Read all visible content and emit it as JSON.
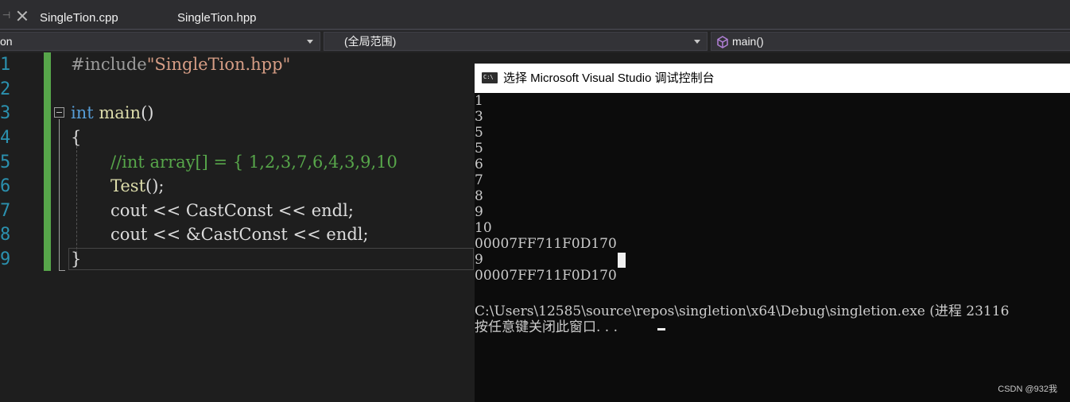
{
  "tabs": [
    {
      "label": "SingleTion.cpp"
    },
    {
      "label": "SingleTion.hpp"
    }
  ],
  "navbar": {
    "project_scope": "on",
    "global_scope": "(全局范围)",
    "function_scope": "main()"
  },
  "editor": {
    "line_numbers": [
      "1",
      "2",
      "3",
      "4",
      "5",
      "6",
      "7",
      "8",
      "9"
    ],
    "lines": [
      {
        "include_kw": "#include",
        "include_path": "\"SingleTion.hpp\""
      },
      {},
      {
        "type_kw": "int",
        "fn_name": "main",
        "parens": "()"
      },
      {
        "text": "{"
      },
      {
        "comment": "//int array[] = { 1,2,3,7,6,4,3,9,10"
      },
      {
        "call": "Test",
        "rest": "();"
      },
      {
        "text": "cout << CastConst << endl;"
      },
      {
        "text": "cout << &CastConst << endl;"
      },
      {
        "text": "}"
      }
    ]
  },
  "console": {
    "title": "选择 Microsoft Visual Studio 调试控制台",
    "output": [
      "1",
      "3",
      "5",
      "5",
      "6",
      "7",
      "8",
      "9",
      "10",
      "00007FF711F0D170",
      "9",
      "00007FF711F0D170",
      "",
      "C:\\Users\\12585\\source\\repos\\singletion\\x64\\Debug\\singletion.exe (进程 23116",
      "按任意键关闭此窗口. . ."
    ]
  },
  "watermark": "CSDN @932我"
}
